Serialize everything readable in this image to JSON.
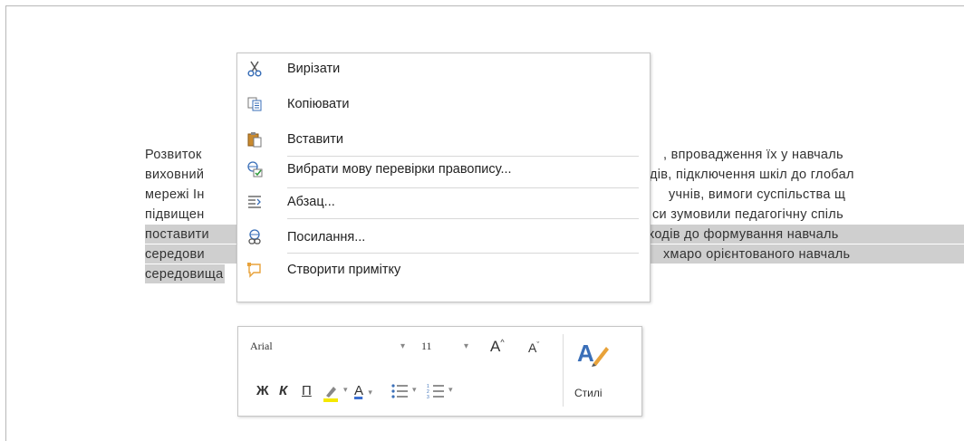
{
  "document": {
    "lines": [
      {
        "left": "Розвиток",
        "right": ", впровадження їх у навчаль"
      },
      {
        "left": "виховний",
        "right": "дів, підключення шкіл до глобал"
      },
      {
        "left": "мережі Ін",
        "right": "учнів, вимоги суспільства щ"
      },
      {
        "left": "підвищен",
        "right": "си зумовили педагогічну спіль"
      },
      {
        "left": "поставити",
        "right": "ходів до формування навчаль"
      },
      {
        "left": "середови",
        "right": "хмаро орієнтованого навчаль"
      },
      {
        "left": "середовища",
        "right": ""
      }
    ]
  },
  "context_menu": {
    "items": [
      {
        "label": "Вирізати",
        "icon": "scissors-icon"
      },
      {
        "label": "Копіювати",
        "icon": "copy-icon"
      },
      {
        "label": "Вставити",
        "icon": "paste-icon"
      },
      {
        "label": "Вибрати мову перевірки правопису...",
        "icon": "language-icon"
      },
      {
        "label": "Абзац...",
        "icon": "paragraph-icon"
      },
      {
        "label": "Посилання...",
        "icon": "link-icon"
      },
      {
        "label": "Створити примітку",
        "icon": "comment-icon"
      }
    ]
  },
  "mini_toolbar": {
    "font_name": "Arial",
    "font_size": "11",
    "grow_font": "A",
    "shrink_font": "A",
    "bold": "Ж",
    "italic": "К",
    "underline": "П",
    "font_color": "A",
    "styles_label": "Стилі",
    "colors": {
      "highlight": "#f5e800",
      "font_color": "#3b6fd0",
      "icon_blue": "#3a6fb8",
      "accent_orange": "#e8a23a"
    }
  }
}
